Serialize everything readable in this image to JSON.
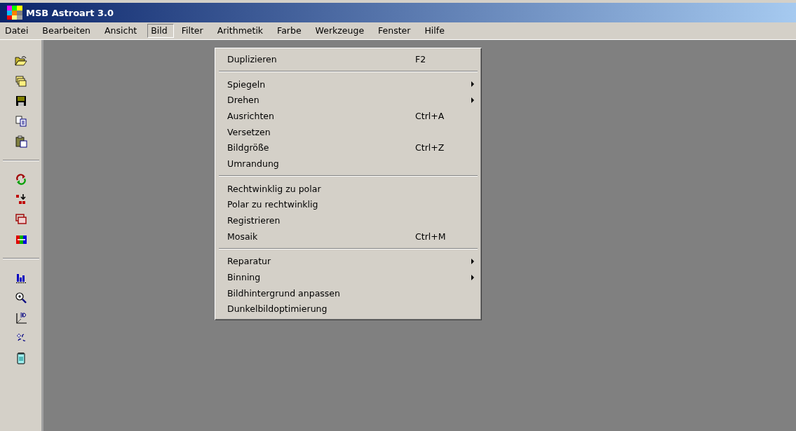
{
  "window": {
    "title": "MSB Astroart 3.0"
  },
  "menubar": [
    {
      "label": "Datei",
      "selected": false
    },
    {
      "label": "Bearbeiten",
      "selected": false
    },
    {
      "label": "Ansicht",
      "selected": false
    },
    {
      "label": "Bild",
      "selected": true
    },
    {
      "label": "Filter",
      "selected": false
    },
    {
      "label": "Arithmetik",
      "selected": false
    },
    {
      "label": "Farbe",
      "selected": false
    },
    {
      "label": "Werkzeuge",
      "selected": false
    },
    {
      "label": "Fenster",
      "selected": false
    },
    {
      "label": "Hilfe",
      "selected": false
    }
  ],
  "menu": {
    "items": [
      {
        "kind": "item",
        "label": "Duplizieren",
        "shortcut": "F2",
        "submenu": false
      },
      {
        "kind": "separator"
      },
      {
        "kind": "item",
        "label": "Spiegeln",
        "submenu": true
      },
      {
        "kind": "item",
        "label": "Drehen",
        "submenu": true
      },
      {
        "kind": "item",
        "label": "Ausrichten",
        "shortcut": "Ctrl+A",
        "submenu": false
      },
      {
        "kind": "item",
        "label": "Versetzen",
        "submenu": false
      },
      {
        "kind": "item",
        "label": "Bildgröße",
        "shortcut": "Ctrl+Z",
        "submenu": false
      },
      {
        "kind": "item",
        "label": "Umrandung",
        "submenu": false
      },
      {
        "kind": "separator"
      },
      {
        "kind": "item",
        "label": "Rechtwinklig zu polar",
        "submenu": false
      },
      {
        "kind": "item",
        "label": "Polar zu rechtwinklig",
        "submenu": false
      },
      {
        "kind": "item",
        "label": "Registrieren",
        "submenu": false
      },
      {
        "kind": "item",
        "label": "Mosaik",
        "shortcut": "Ctrl+M",
        "submenu": false
      },
      {
        "kind": "separator"
      },
      {
        "kind": "item",
        "label": "Reparatur",
        "submenu": true
      },
      {
        "kind": "item",
        "label": "Binning",
        "submenu": true
      },
      {
        "kind": "item",
        "label": "Bildhintergrund anpassen",
        "submenu": false
      },
      {
        "kind": "item",
        "label": "Dunkelbildoptimierung",
        "submenu": false
      }
    ]
  }
}
